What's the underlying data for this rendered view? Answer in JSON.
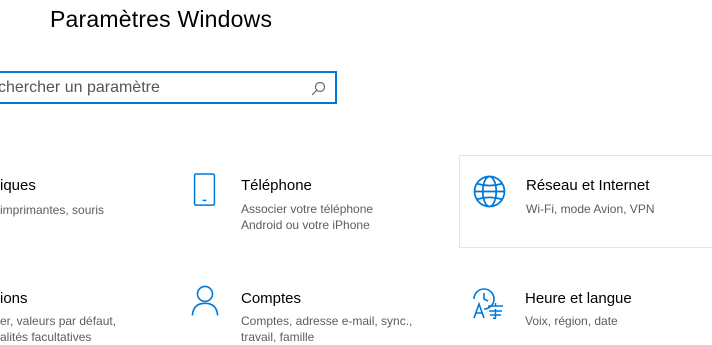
{
  "window": {
    "title": "Paramètres Windows"
  },
  "search": {
    "placeholder": "Rechercher un paramètre",
    "value": "chercher un paramètre"
  },
  "tiles": [
    {
      "name": "iques",
      "desc_line1": "imprimantes, souris",
      "desc_line2": "",
      "icon": "none"
    },
    {
      "name": "Téléphone",
      "desc_line1": "Associer votre téléphone",
      "desc_line2": "Android ou votre iPhone",
      "icon": "phone-icon"
    },
    {
      "name": "Réseau et Internet",
      "desc_line1": "Wi-Fi, mode Avion, VPN",
      "desc_line2": "",
      "icon": "globe-icon"
    },
    {
      "name": "ions",
      "desc_line1": "er, valeurs par défaut,",
      "desc_line2": "alités facultatives",
      "icon": "none"
    },
    {
      "name": "Comptes",
      "desc_line1": "Comptes, adresse e-mail, sync.,",
      "desc_line2": "travail, famille",
      "icon": "person-icon"
    },
    {
      "name": "Heure et langue",
      "desc_line1": "Voix, région, date",
      "desc_line2": "",
      "icon": "time-language-icon"
    }
  ],
  "colors": {
    "accent": "#0078d7",
    "text": "#000000",
    "secondary_text": "#5d5d5d",
    "hover_border": "#e4e4e4"
  }
}
